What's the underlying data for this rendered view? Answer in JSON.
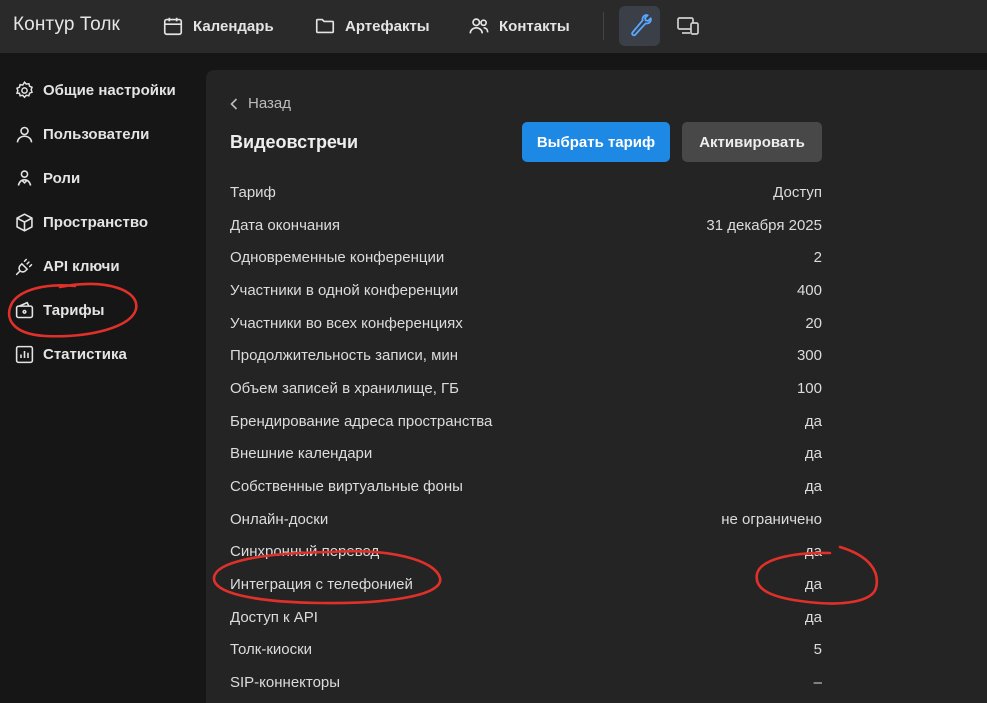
{
  "app": {
    "logo": "Контур Толк"
  },
  "topnav": {
    "calendar": "Календарь",
    "artifacts": "Артефакты",
    "contacts": "Контакты"
  },
  "sidebar": {
    "items": [
      {
        "label": "Общие настройки",
        "icon": "gear-icon"
      },
      {
        "label": "Пользователи",
        "icon": "user-icon"
      },
      {
        "label": "Роли",
        "icon": "roles-icon"
      },
      {
        "label": "Пространство",
        "icon": "cube-icon"
      },
      {
        "label": "API ключи",
        "icon": "plug-icon"
      },
      {
        "label": "Тарифы",
        "icon": "wallet-icon"
      },
      {
        "label": "Статистика",
        "icon": "stats-icon"
      }
    ]
  },
  "main": {
    "back_label": "Назад",
    "title": "Видеовстречи",
    "choose_tariff": "Выбрать тариф",
    "activate": "Активировать",
    "rows": [
      {
        "label": "Тариф",
        "value": "Доступ"
      },
      {
        "label": "Дата окончания",
        "value": "31 декабря 2025"
      },
      {
        "label": "Одновременные конференции",
        "value": "2"
      },
      {
        "label": "Участники в одной конференции",
        "value": "400"
      },
      {
        "label": "Участники во всех конференциях",
        "value": "20"
      },
      {
        "label": "Продолжительность записи, мин",
        "value": "300"
      },
      {
        "label": "Объем записей в хранилище, ГБ",
        "value": "100"
      },
      {
        "label": "Брендирование адреса пространства",
        "value": "да"
      },
      {
        "label": "Внешние календари",
        "value": "да"
      },
      {
        "label": "Собственные виртуальные фоны",
        "value": "да"
      },
      {
        "label": "Онлайн-доски",
        "value": "не ограничено"
      },
      {
        "label": "Синхронный перевод",
        "value": "да"
      },
      {
        "label": "Интеграция с телефонией",
        "value": "да"
      },
      {
        "label": "Доступ к API",
        "value": "да"
      },
      {
        "label": "Толк-киоски",
        "value": "5"
      },
      {
        "label": "SIP-коннекторы",
        "value": "–"
      }
    ]
  },
  "colors": {
    "accent": "#1e88e5",
    "annotation": "#e0302a",
    "background": "#161616",
    "panel": "#242424"
  }
}
